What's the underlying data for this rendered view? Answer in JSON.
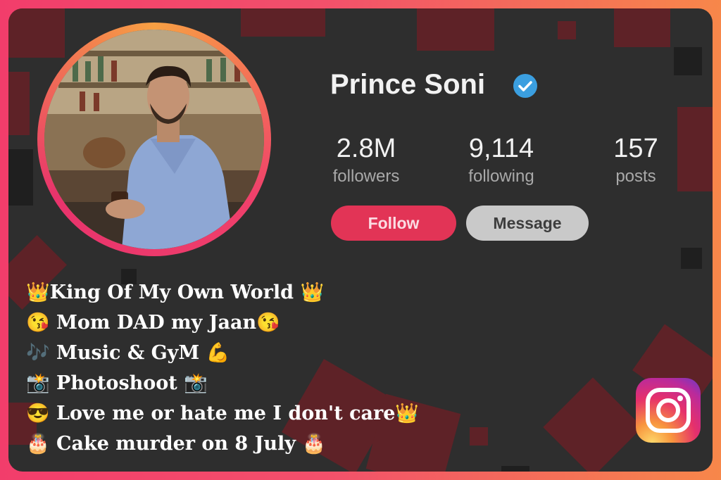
{
  "profile": {
    "name": "Prince Soni",
    "verified_icon": "verified-badge-icon",
    "avatar_description_icon": "profile-photo"
  },
  "stats": [
    {
      "value": "2.8M",
      "label": "followers"
    },
    {
      "value": "9,114",
      "label": "following"
    },
    {
      "value": "157",
      "label": "posts"
    }
  ],
  "buttons": {
    "follow": "Follow",
    "message": "Message"
  },
  "bio": [
    "👑King Of My Own World 👑",
    "😘 Mom DAD my Jaan😘",
    "🎶 Music & GyM 💪",
    "📸 Photoshoot 📸",
    "😎 Love me or hate me I don't care👑",
    "🎂 Cake murder on 8 July 🎂"
  ],
  "logo_icon": "instagram-logo-icon",
  "colors": {
    "frame_start": "#f23d6b",
    "frame_end": "#f7874a",
    "card_bg": "#2e2e2e",
    "follow_bg": "#e23456",
    "message_bg": "#c9c9c9",
    "verified": "#3b9fe0"
  }
}
